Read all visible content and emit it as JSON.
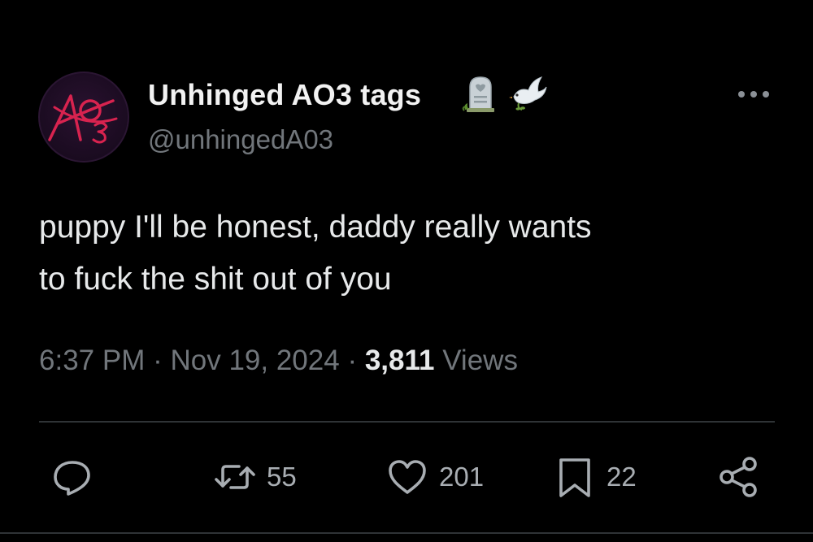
{
  "user": {
    "display_name": "Unhinged AO3 tags",
    "handle": "@unhingedA03",
    "avatar_icon": "ao3-logo-icon",
    "name_emojis": [
      "headstone-emoji",
      "dove-emoji"
    ]
  },
  "tweet": {
    "text_lines": [
      "puppy I'll be honest, daddy really wants",
      "to fuck the shit out of you"
    ],
    "time": "6:37 PM",
    "separator": "·",
    "date": "Nov 19, 2024",
    "views_count": "3,811",
    "views_label": "Views"
  },
  "actions": {
    "reply": {
      "icon": "reply-icon",
      "count": ""
    },
    "retweet": {
      "icon": "retweet-icon",
      "count": "55"
    },
    "like": {
      "icon": "heart-icon",
      "count": "201"
    },
    "bookmark": {
      "icon": "bookmark-icon",
      "count": "22"
    },
    "share": {
      "icon": "share-icon",
      "count": ""
    }
  },
  "menu": {
    "icon": "more-options-icon"
  },
  "colors": {
    "background": "#000000",
    "primary_text": "#e7e9ea",
    "secondary_text": "#71767b",
    "divider": "#2f3336",
    "avatar_accent": "#d8234f"
  }
}
